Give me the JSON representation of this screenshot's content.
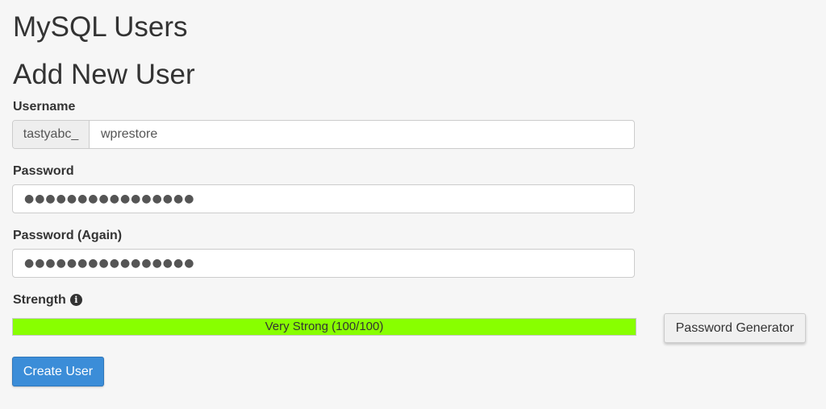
{
  "page": {
    "title": "MySQL Users",
    "section_title": "Add New User"
  },
  "username": {
    "label": "Username",
    "prefix": "tastyabc_",
    "value": "wprestore"
  },
  "password": {
    "label": "Password",
    "masked_value": "●●●●●●●●●●●●●●●●"
  },
  "password_again": {
    "label": "Password (Again)",
    "masked_value": "●●●●●●●●●●●●●●●●"
  },
  "strength": {
    "label": "Strength",
    "info_icon": "info-circle-icon",
    "text": "Very Strong (100/100)",
    "score": 100,
    "max": 100,
    "bar_color": "#88ff00"
  },
  "buttons": {
    "password_generator": "Password Generator",
    "create_user": "Create User",
    "create_user_color": "#3b8dd8"
  }
}
